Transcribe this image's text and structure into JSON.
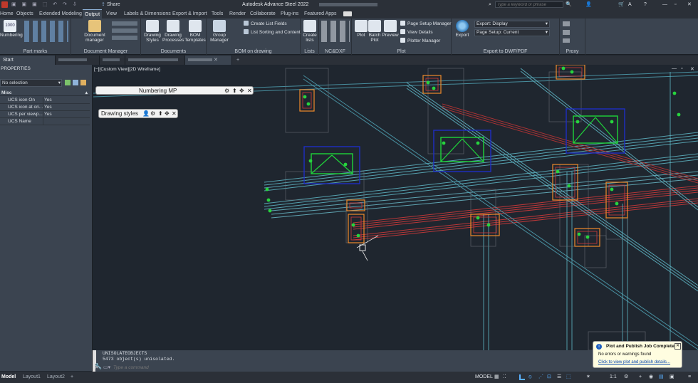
{
  "titlebar": {
    "title": "Autodesk Advance Steel 2022",
    "share": "Share",
    "search_placeholder": "Type a keyword or phrase"
  },
  "ribbon_tabs": [
    "Home",
    "Objects",
    "Extended Modeling",
    "Output",
    "View",
    "Labels & Dimensions",
    "Export & Import",
    "Tools",
    "Render",
    "Collaborate",
    "Plug-ins",
    "Featured Apps"
  ],
  "ribbon": {
    "part_marks": {
      "label": "Part marks",
      "numbering": "Numbering"
    },
    "document_manager": {
      "label": "Document Manager",
      "button": "Document manager"
    },
    "documents": {
      "label": "Documents",
      "drawing_styles": "Drawing Styles",
      "drawing_processes": "Drawing Processes",
      "bom_templates": "BOM Templates"
    },
    "bom": {
      "label": "BOM on drawing",
      "group_manager": "Group Manager",
      "create_list_fields": "Create List Fields",
      "list_sorting": "List Sorting and Content"
    },
    "lists": {
      "label": "Lists",
      "create_lists": "Create lists"
    },
    "ncdxf": {
      "label": "NC&DXF"
    },
    "plot": {
      "label": "Plot",
      "plot": "Plot",
      "batch_plot": "Batch Plot",
      "preview": "Preview",
      "page_setup_manager": "Page Setup Manager",
      "view_details": "View Details",
      "plotter_manager": "Plotter Manager"
    },
    "export_dwf": {
      "label": "Export to DWF/PDF",
      "export": "Export",
      "export_display": "Export: Display",
      "page_setup": "Page Setup: Current"
    },
    "proxy": {
      "label": "Proxy"
    }
  },
  "doc_tabs": [
    "Start",
    "",
    "",
    "",
    ""
  ],
  "properties": {
    "title": "PROPERTIES",
    "selection": "No selection",
    "section": "Misc",
    "rows": [
      [
        "UCS icon On",
        "Yes"
      ],
      [
        "UCS icon at ori...",
        "Yes"
      ],
      [
        "UCS per viewp...",
        "Yes"
      ],
      [
        "UCS Name",
        ""
      ]
    ]
  },
  "viewport": {
    "label": "[−][Custom View][2D Wireframe]",
    "numbering_bar": "Numbering MP",
    "drawing_styles_bar": "Drawing styles"
  },
  "command": {
    "line1": "UNISOLATEOBJECTS",
    "line2": "5473 object(s) unisolated.",
    "placeholder": "Type a command"
  },
  "status": {
    "tabs": [
      "Model",
      "Layout1",
      "Layout2"
    ],
    "model": "MODEL",
    "scale": "1:1"
  },
  "notification": {
    "title": "Plot and Publish Job Complete",
    "body": "No errors or warnings found",
    "link": "Click to view plot and publish details..."
  }
}
